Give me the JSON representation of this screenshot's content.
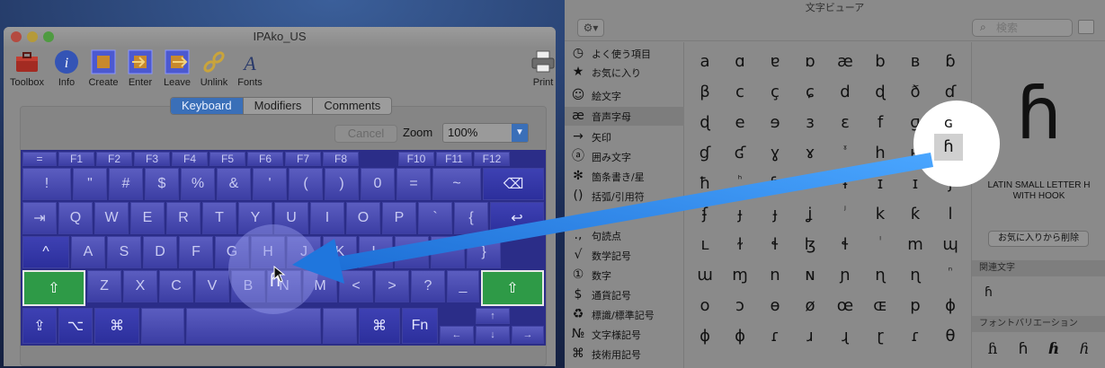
{
  "left_window": {
    "title": "IPAko_US",
    "toolbar": [
      {
        "label": "Toolbox",
        "icon": "toolbox-icon"
      },
      {
        "label": "Info",
        "icon": "info-icon"
      },
      {
        "label": "Create",
        "icon": "create-icon"
      },
      {
        "label": "Enter",
        "icon": "enter-icon"
      },
      {
        "label": "Leave",
        "icon": "leave-icon"
      },
      {
        "label": "Unlink",
        "icon": "unlink-icon"
      },
      {
        "label": "Fonts",
        "icon": "fonts-icon"
      },
      {
        "label": "Print",
        "icon": "printer-icon"
      }
    ],
    "tabs": [
      "Keyboard",
      "Modifiers",
      "Comments"
    ],
    "active_tab": "Keyboard",
    "cancel_label": "Cancel",
    "zoom_label": "Zoom",
    "zoom_value": "100%",
    "keyboard": {
      "row_fn": [
        "=",
        "F1",
        "F2",
        "F3",
        "F4",
        "F5",
        "F6",
        "F7",
        "F8",
        "F10",
        "F11",
        "F12"
      ],
      "row_num": [
        "!",
        "\"",
        "#",
        "$",
        "%",
        "&",
        "'",
        "(",
        ")",
        "0",
        "=",
        "~",
        "⌫"
      ],
      "row_q": [
        "⇥",
        "Q",
        "W",
        "E",
        "R",
        "T",
        "Y",
        "U",
        "I",
        "O",
        "P",
        "`",
        "{",
        "↩"
      ],
      "row_a": [
        "^",
        "A",
        "S",
        "D",
        "F",
        "G",
        "H",
        "J",
        "K",
        "L",
        "+",
        "*",
        "}"
      ],
      "row_z": [
        "⇧",
        "Z",
        "X",
        "C",
        "V",
        "B",
        "N",
        "M",
        "<",
        ">",
        "?",
        "_",
        "⇧"
      ],
      "row_bottom": [
        "⇪",
        "⌥",
        "⌘",
        "⌘",
        "Fn"
      ],
      "arrows": [
        "↑",
        "←",
        "↓",
        "→"
      ],
      "selected_char": "ɦ"
    }
  },
  "right_window": {
    "title": "文字ビューア",
    "search_placeholder": "検索",
    "categories": [
      {
        "icon": "🕘",
        "label": "よく使う項目"
      },
      {
        "icon": "★",
        "label": "お気に入り"
      },
      {
        "icon": "☺",
        "label": "絵文字"
      },
      {
        "icon": "æ",
        "label": "音声字母"
      },
      {
        "icon": "→",
        "label": "矢印"
      },
      {
        "icon": "ⓐ",
        "label": "囲み文字"
      },
      {
        "icon": "✻",
        "label": "箇条書き/星"
      },
      {
        "icon": "()",
        "label": "括弧/引用符"
      },
      {
        "icon": "",
        "label": ""
      },
      {
        "icon": ".,",
        "label": "句読点"
      },
      {
        "icon": "√",
        "label": "数学記号"
      },
      {
        "icon": "①",
        "label": "数字"
      },
      {
        "icon": "$",
        "label": "通貨記号"
      },
      {
        "icon": "♻",
        "label": "標識/標準記号"
      },
      {
        "icon": "№",
        "label": "文字様記号"
      },
      {
        "icon": "⌘",
        "label": "技術用記号"
      }
    ],
    "selected_category": "音声字母",
    "glyphs": [
      [
        "a",
        "ɑ",
        "ɐ",
        "ɒ",
        "æ",
        "b",
        "ʙ",
        "ɓ"
      ],
      [
        "β",
        "c",
        "ç",
        "ɕ",
        "d",
        "ɖ",
        "ð",
        "ɗ"
      ],
      [
        "ɖ",
        "e",
        "ɘ",
        "ɜ",
        "ɛ",
        "f",
        "ɡ",
        "ɢ"
      ],
      [
        "ɠ",
        "ʛ",
        "ɣ",
        "ɤ",
        "ˠ",
        "h",
        "ʜ",
        "ɦ"
      ],
      [
        "ħ",
        "ʰ",
        "ɧ",
        "i",
        "ɨ",
        "ɪ",
        "ɪ",
        "j"
      ],
      [
        "ʄ",
        "ɟ",
        "ɟ",
        "ʝ",
        "ʲ",
        "k",
        "ƙ",
        "l"
      ],
      [
        "ʟ",
        "ɫ",
        "ɬ",
        "ɮ",
        "ɬ",
        "ˡ",
        "m",
        "ɰ"
      ],
      [
        "ɯ",
        "ɱ",
        "n",
        "ɴ",
        "ɲ",
        "ɳ",
        "ɳ",
        "ⁿ"
      ],
      [
        "o",
        "ɔ",
        "ɵ",
        "ø",
        "œ",
        "ɶ",
        "p",
        "ɸ"
      ],
      [
        "ɸ",
        "ɸ",
        "ɾ",
        "ɹ",
        "ɻ",
        "ɽ",
        "ɾ",
        "θ"
      ]
    ],
    "detail": {
      "char": "ɦ",
      "name": "LATIN SMALL LETTER H WITH HOOK",
      "favorite_button": "お気に入りから削除",
      "related_heading": "関連文字",
      "related": [
        "ɦ"
      ],
      "font_variation_heading": "フォントバリエーション",
      "variations": [
        "ɦ",
        "ɦ",
        "ɦ",
        "ɦ"
      ]
    }
  },
  "colors": {
    "accent": "#3a6fb8",
    "arrow": "#2f86e8",
    "key_green": "#2e9a47",
    "keyboard_bg": "#2b2d88"
  }
}
